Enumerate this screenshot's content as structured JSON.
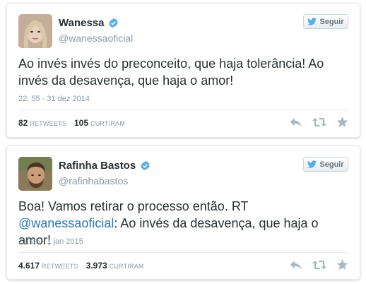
{
  "tweets": [
    {
      "display_name": "Wanessa",
      "screen_name": "@wanessaoficial",
      "follow_label": "Seguir",
      "text": "Ao invés invés do preconceito, que haja tolerância! Ao invés da desavença, que haja o amor!",
      "text_prefix": "",
      "mention": "",
      "text_suffix": "",
      "timestamp": "22: 55 - 31 dez 2014",
      "retweets": "82",
      "retweets_label": "RETWEETS",
      "likes": "105",
      "likes_label": "CURTIRAM"
    },
    {
      "display_name": "Rafinha Bastos",
      "screen_name": "@rafinhabastos",
      "follow_label": "Seguir",
      "text": "",
      "text_prefix": "Boa! Vamos retirar o processo então. RT ",
      "mention": "@wanessaoficial",
      "text_suffix": ": Ao invés da desavença, que haja o amor!",
      "timestamp": "21: 35 - 1 jan 2015",
      "retweets": "4.617",
      "retweets_label": "RETWEETS",
      "likes": "3.973",
      "likes_label": "CURTIRAM"
    }
  ],
  "colors": {
    "verified": "#55acee",
    "mention": "#2b7bb9",
    "muted": "#8899a6",
    "action_icon": "#aab8c2"
  },
  "icons": [
    "verified-badge-icon",
    "twitter-bird-icon",
    "reply-icon",
    "retweet-icon",
    "favorite-star-icon"
  ]
}
